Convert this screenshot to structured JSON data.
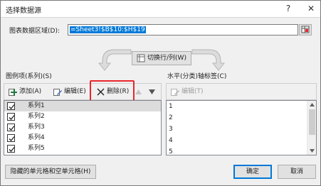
{
  "dialog": {
    "title": "选择数据源",
    "help_glyph": "?",
    "close_glyph": "✕"
  },
  "range": {
    "label": "图表数据区域(D):",
    "value": "=Sheet3!$B$10:$H$19"
  },
  "switch_button": {
    "label": "切换行/列(W)"
  },
  "legend": {
    "header": "图例项(系列)(S)",
    "add_label": "添加(A)",
    "edit_label": "编辑(E)",
    "remove_label": "删除(R)",
    "series": [
      {
        "label": "系列1",
        "checked": true
      },
      {
        "label": "系列2",
        "checked": true
      },
      {
        "label": "系列3",
        "checked": true
      },
      {
        "label": "系列4",
        "checked": true
      },
      {
        "label": "系列5",
        "checked": true
      }
    ]
  },
  "axis": {
    "header": "水平(分类)轴标签(C)",
    "edit_label": "编辑(T)",
    "items": [
      "1",
      "2",
      "3",
      "4",
      "5"
    ]
  },
  "footer": {
    "hidden_cells_label": "隐藏的单元格和空单元格(H)",
    "ok_label": "确定",
    "cancel_label": "取消"
  },
  "colors": {
    "highlight": "#e8262c",
    "selection": "#0078d7",
    "remove_x": "#1f1f1f",
    "add_icon": "#1e7a3c"
  }
}
